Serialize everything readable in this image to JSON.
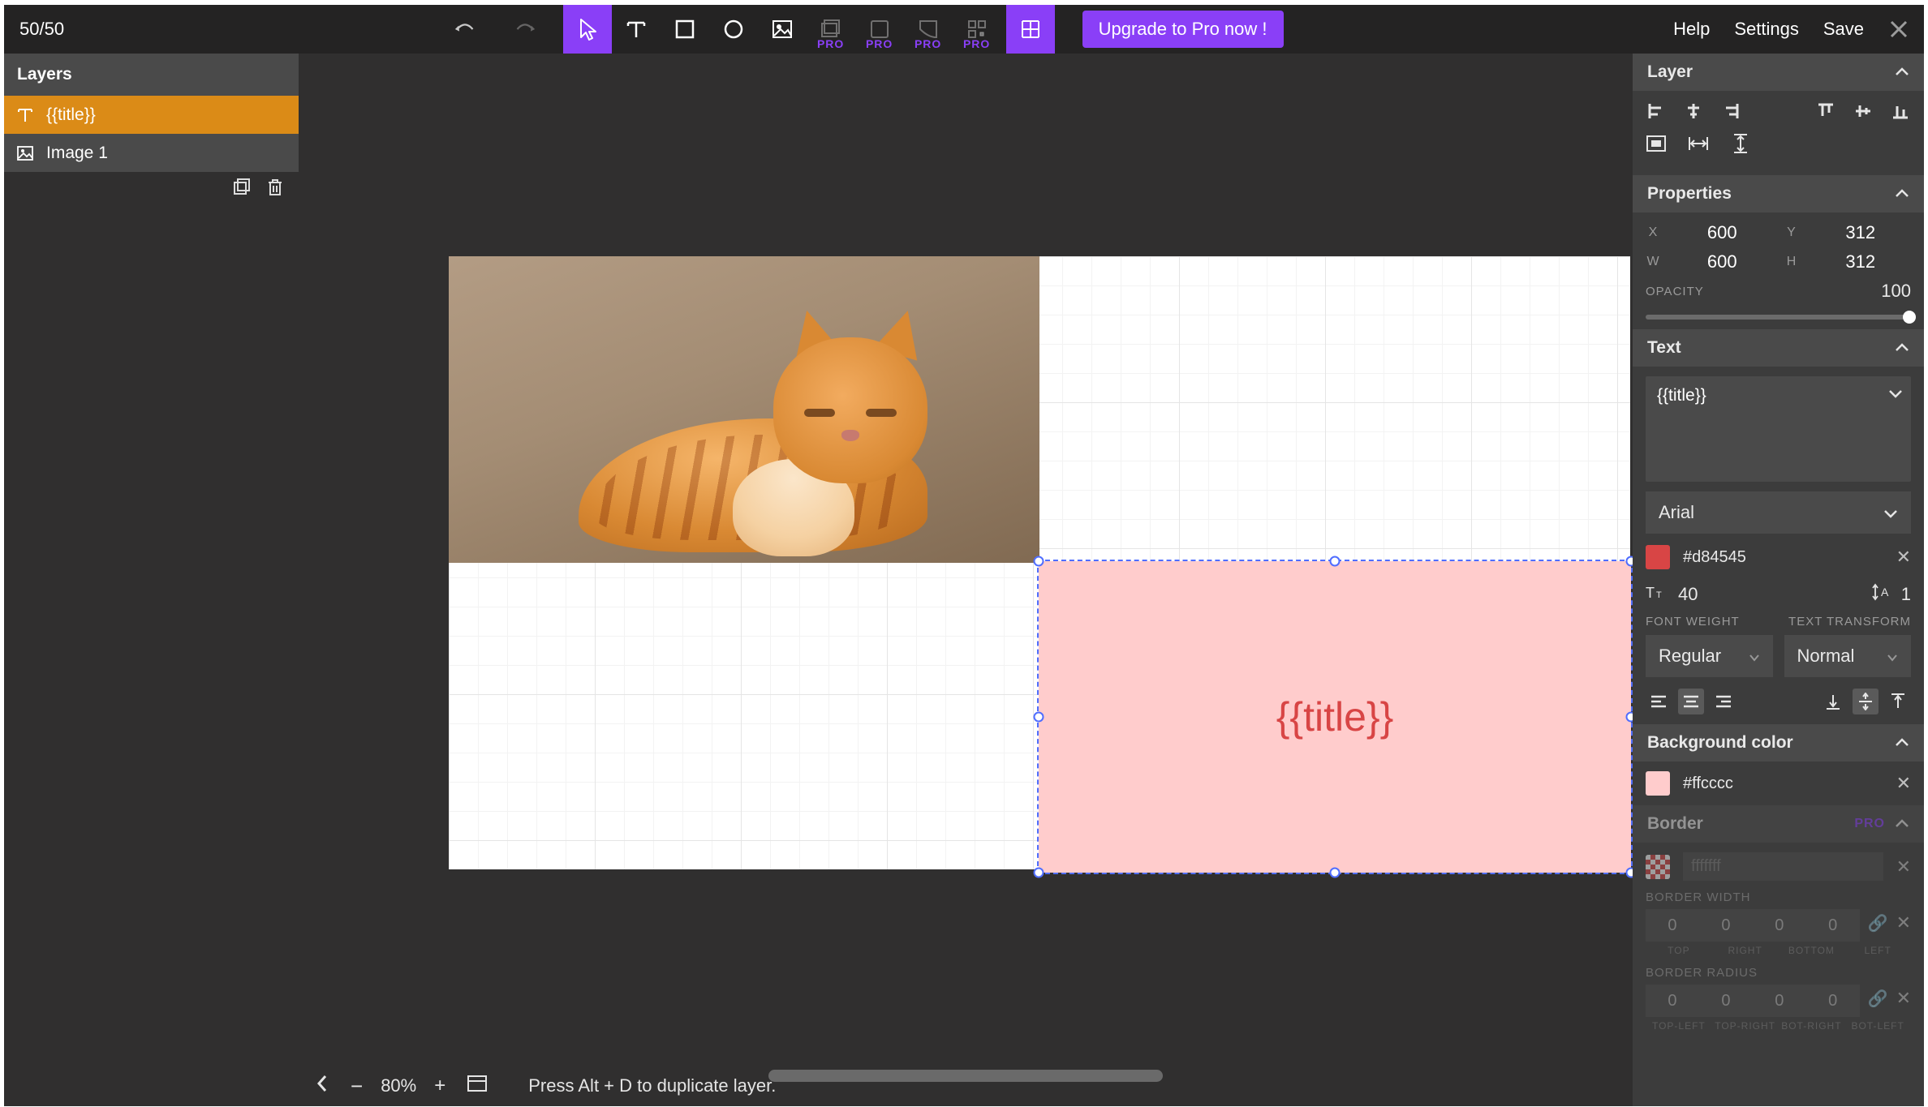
{
  "topbar": {
    "counter": "50/50",
    "upgrade": "Upgrade to Pro now !",
    "help": "Help",
    "settings": "Settings",
    "save": "Save",
    "pro": "PRO"
  },
  "layers": {
    "header": "Layers",
    "items": [
      {
        "name": "{{title}}",
        "type": "text",
        "selected": true
      },
      {
        "name": "Image 1",
        "type": "image",
        "selected": false
      }
    ]
  },
  "canvas": {
    "selected_text": "{{title}}",
    "zoom": "80%",
    "hint": "Press Alt + D to duplicate layer."
  },
  "panel": {
    "layer_header": "Layer",
    "properties_header": "Properties",
    "x_label": "X",
    "x": "600",
    "y_label": "Y",
    "y": "312",
    "w_label": "W",
    "w": "600",
    "h_label": "H",
    "h": "312",
    "opacity_label": "OPACITY",
    "opacity": "100",
    "text_header": "Text",
    "text_value": "{{title}}",
    "font_family": "Arial",
    "text_color": "#d84545",
    "font_size": "40",
    "line_height": "1",
    "font_weight_label": "FONT WEIGHT",
    "font_weight": "Regular",
    "text_transform_label": "TEXT TRANSFORM",
    "text_transform": "Normal",
    "bg_header": "Background color",
    "bg_color": "#ffcccc",
    "border_header": "Border",
    "border_color_placeholder": "fffffff",
    "border_width_label": "BORDER WIDTH",
    "border_width": {
      "top": "0",
      "right": "0",
      "bottom": "0",
      "left": "0"
    },
    "border_width_sides": {
      "a": "TOP",
      "b": "RIGHT",
      "c": "BOTTOM",
      "d": "LEFT"
    },
    "border_radius_label": "BORDER RADIUS",
    "border_radius": {
      "tl": "0",
      "tr": "0",
      "br": "0",
      "bl": "0"
    },
    "border_radius_sides": {
      "a": "TOP-LEFT",
      "b": "TOP-RIGHT",
      "c": "BOT-RIGHT",
      "d": "BOT-LEFT"
    }
  }
}
